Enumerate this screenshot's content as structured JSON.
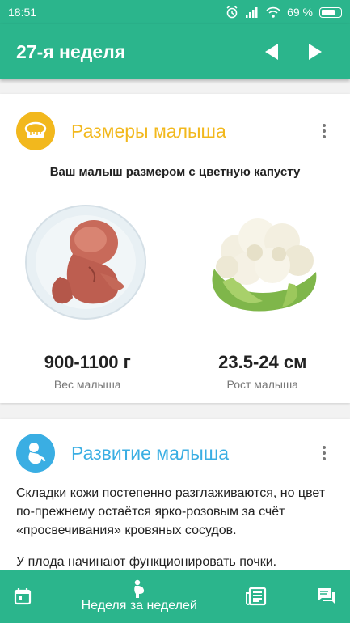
{
  "status_bar": {
    "time": "18:51",
    "battery": "69 %",
    "icons": [
      "alarm-icon",
      "signal-icon",
      "wifi-icon",
      "battery-icon"
    ]
  },
  "app_bar": {
    "title": "27-я неделя",
    "prev_icon": "chevron-left-icon",
    "next_icon": "chevron-right-icon"
  },
  "size_card": {
    "title": "Размеры малыша",
    "title_color": "#f2b81d",
    "icon": "tape-measure-icon",
    "comparison": "Ваш малыш размером с цветную капусту",
    "weight_value": "900-1100 г",
    "weight_label": "Вес малыша",
    "length_value": "23.5-24 см",
    "length_label": "Рост малыша",
    "images": [
      "fetus-image",
      "cauliflower-image"
    ]
  },
  "dev_card": {
    "title": "Развитие малыша",
    "title_color": "#3aaee3",
    "icon": "baby-icon",
    "paragraph1": "Складки кожи постепенно разглаживаются, но цвет по-прежнему остаётся ярко-розовым за счёт «просвечивания» кровяных сосудов.",
    "paragraph2": "У плода начинают функционировать почки. Образующаяся моча выводится в окружающие"
  },
  "bottom_nav": {
    "center_label": "Неделя за неделей",
    "items": [
      "calendar-icon",
      "pregnancy-icon",
      "articles-icon",
      "chat-icon"
    ]
  },
  "colors": {
    "primary": "#2bb58c",
    "size_accent": "#f2b81d",
    "dev_accent": "#3aaee3"
  }
}
